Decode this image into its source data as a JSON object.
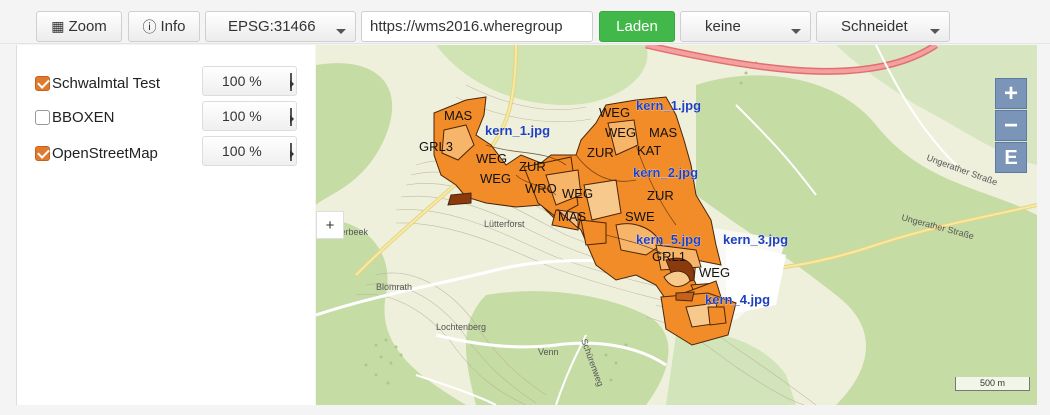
{
  "toolbar": {
    "zoom_label": "Zoom",
    "info_label": "Info",
    "epsg_value": "EPSG:31466",
    "url_value": "https://wms2016.wheregroup",
    "laden_label": "Laden",
    "select1_value": "keine",
    "select2_value": "Schneidet"
  },
  "layers": [
    {
      "label": "Schwalmtal Test",
      "checked": true,
      "opacity": "100 %"
    },
    {
      "label": "BBOXEN",
      "checked": false,
      "opacity": "100 %"
    },
    {
      "label": "OpenStreetMap",
      "checked": true,
      "opacity": "100 %"
    }
  ],
  "map": {
    "toggle_label": "+",
    "zoom_in": "+",
    "zoom_out": "−",
    "extent": "E",
    "scale_label": "500 m",
    "labels": {
      "mas1": "MAS",
      "grl3": "GRL3",
      "kern1a": "kern_1.jpg",
      "kern1b": "kern_1.jpg",
      "weg1": "WEG",
      "weg2": "WEG",
      "mas2": "MAS",
      "zur1": "ZUR",
      "kat": "KAT",
      "weg3": "WEG",
      "zur2": "ZUR",
      "weg4": "WEG",
      "wro": "WRO",
      "weg5": "WEG",
      "kern2": "kern_2.jpg",
      "zur3": "ZUR",
      "mas3": "MAS",
      "swe": "SWE",
      "kern5": "kern_5.jpg",
      "kern3": "kern_3.jpg",
      "grl1": "GRL1",
      "weg6": "WEG",
      "kern4": "kern_4.jpg",
      "ungerather": "Ungerather Straße",
      "ungerather2": "Ungerather Straße",
      "silverbeek": "Silverbeek",
      "blomrath": "Blomrath",
      "lochtenberg": "Lochtenberg",
      "venn": "Venn",
      "lutterforst": "Lütterforst",
      "schuerstraeg": "Schürenweg"
    }
  },
  "colors": {
    "laden": "#43b84a",
    "parcel": "#f28c28",
    "parcel_light": "#f7c68a",
    "parcel_dark": "#8b3a0e",
    "label_blue": "#1e3fbf",
    "zoom_btn": "#7a95b8"
  }
}
